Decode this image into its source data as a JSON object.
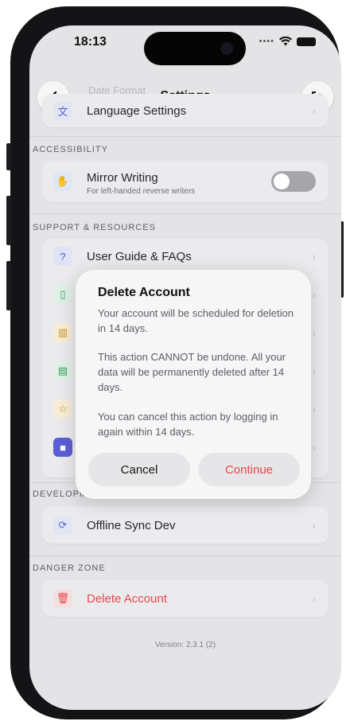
{
  "status_bar": {
    "time": "18:13"
  },
  "header": {
    "title": "Settings",
    "ghost_text": "Date Format"
  },
  "general": {
    "items": [
      {
        "label": "Language Settings",
        "icon": "translate-icon"
      }
    ]
  },
  "accessibility": {
    "heading": "ACCESSIBILITY",
    "mirror_writing": {
      "label": "Mirror Writing",
      "sublabel": "For left-handed reverse writers",
      "enabled": false
    }
  },
  "support": {
    "heading": "SUPPORT & RESOURCES",
    "items": [
      {
        "label": "User Guide & FAQs",
        "icon": "help-circle-icon"
      }
    ]
  },
  "development": {
    "heading": "DEVELOPMENT",
    "items": [
      {
        "label": "Offline Sync Dev",
        "icon": "sync-icon"
      }
    ]
  },
  "danger": {
    "heading": "DANGER ZONE",
    "items": [
      {
        "label": "Delete Account",
        "icon": "trash-icon"
      }
    ]
  },
  "version": "Version: 2.3.1 (2)",
  "dialog": {
    "title": "Delete Account",
    "p1": "Your account will be scheduled for deletion in 14 days.",
    "p2": "This action CANNOT be undone. All your data will be permanently deleted after 14 days.",
    "p3": "You can cancel this action by logging in again within 14 days.",
    "cancel_label": "Cancel",
    "continue_label": "Continue"
  },
  "colors": {
    "danger": "#e5484d",
    "accent": "#5b5fd6"
  }
}
